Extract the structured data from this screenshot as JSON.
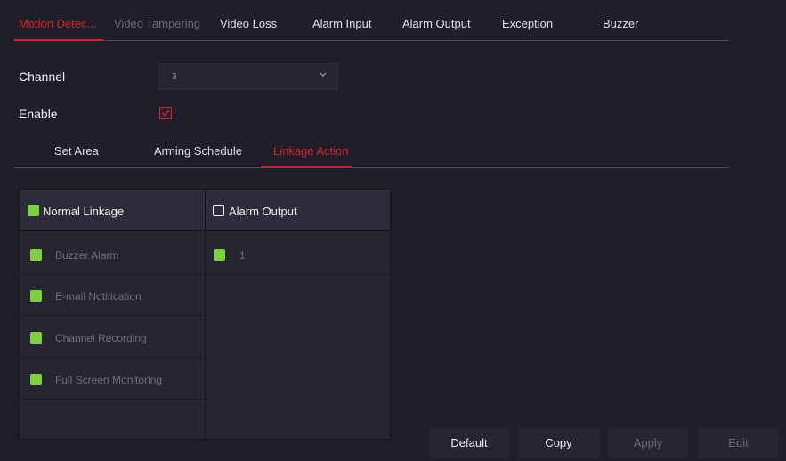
{
  "top_tabs": [
    {
      "label": "Motion Detec...",
      "state": "active"
    },
    {
      "label": "Video Tampering",
      "state": "disabled"
    },
    {
      "label": "Video Loss",
      "state": "normal"
    },
    {
      "label": "Alarm Input",
      "state": "normal"
    },
    {
      "label": "Alarm Output",
      "state": "normal"
    },
    {
      "label": "Exception",
      "state": "normal"
    },
    {
      "label": "Buzzer",
      "state": "normal"
    }
  ],
  "channel": {
    "label": "Channel",
    "value": "3"
  },
  "enable": {
    "label": "Enable",
    "checked": true
  },
  "sub_tabs": [
    {
      "label": "Set Area",
      "state": "normal"
    },
    {
      "label": "Arming Schedule",
      "state": "normal"
    },
    {
      "label": "Linkage Action",
      "state": "active"
    }
  ],
  "normal_linkage": {
    "title": "Normal Linkage",
    "checked": true,
    "items": [
      {
        "label": "Buzzer Alarm",
        "checked": true
      },
      {
        "label": "E-mail Notification",
        "checked": true
      },
      {
        "label": "Channel Recording",
        "checked": true
      },
      {
        "label": "Full Screen Monitoring",
        "checked": true
      }
    ]
  },
  "alarm_output": {
    "title": "Alarm Output",
    "checked": false,
    "items": [
      {
        "label": "1",
        "checked": true
      }
    ]
  },
  "buttons": {
    "default": "Default",
    "copy": "Copy",
    "apply": "Apply",
    "edit": "Edit"
  },
  "colors": {
    "accent": "#d8232a",
    "check_green": "#7dd33f",
    "background": "#1f1f2a"
  }
}
